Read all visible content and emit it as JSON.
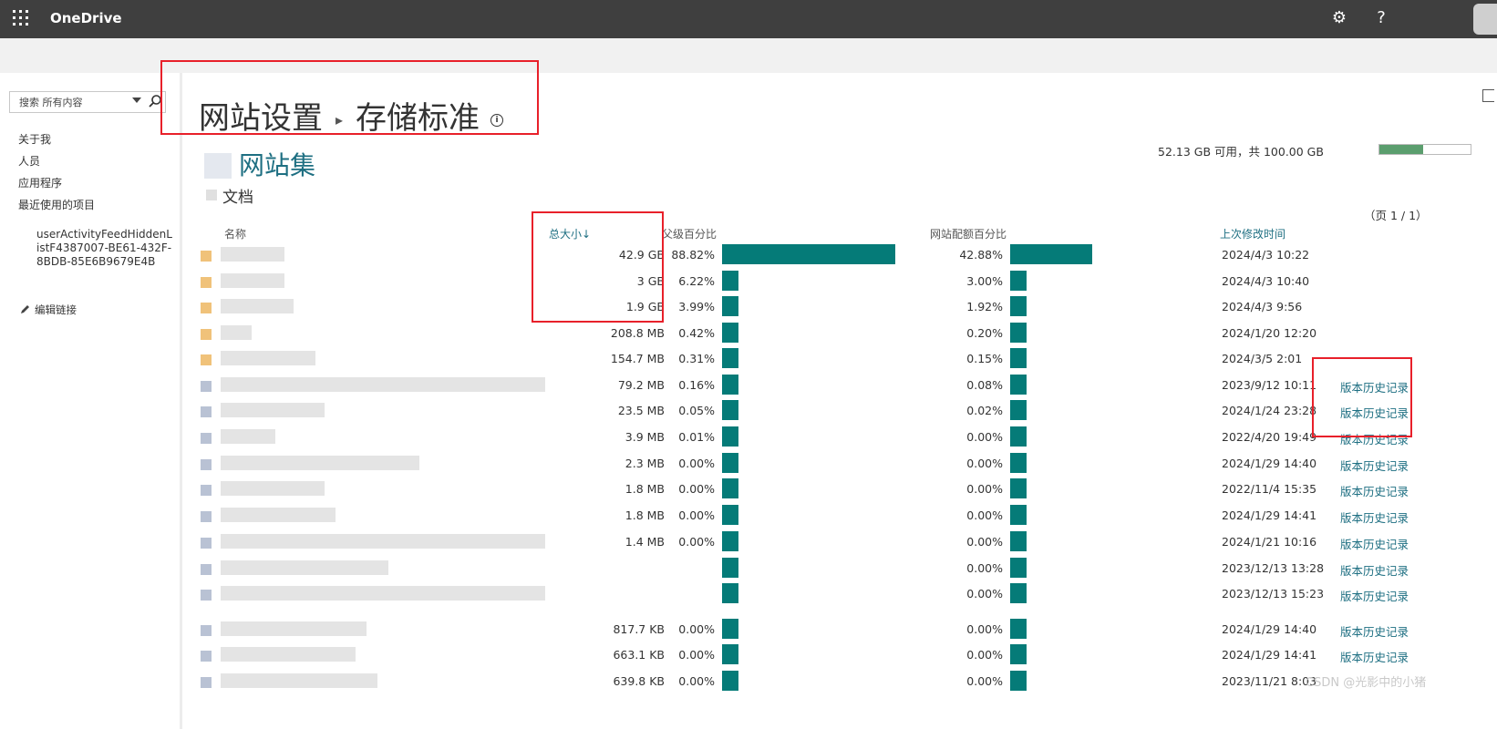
{
  "topbar": {
    "brand": "OneDrive",
    "help": "?"
  },
  "sidebar": {
    "search_placeholder": "搜索 所有内容",
    "nav": [
      "关于我",
      "人员",
      "应用程序",
      "最近使用的项目"
    ],
    "recent_item": "userActivityFeedHiddenListF4387007-BE61-432F-8BDB-85E6B9679E4B",
    "edit_links": "编辑链接"
  },
  "header": {
    "crumb_site_settings": "网站设置",
    "crumb_storage_metrics": "存储标准",
    "section_title": "网站集",
    "sub_title": "文档",
    "quota_text": "52.13 GB 可用，共 100.00 GB",
    "quota_used_fraction": 0.48,
    "pager": "（页 1 / 1）"
  },
  "table": {
    "col_name": "名称",
    "col_total_size": "总大小",
    "col_parent_pct": "父级百分比",
    "col_quota_pct": "网站配额百分比",
    "col_modified": "上次修改时间",
    "rows": [
      {
        "size": "42.9 GB",
        "parent_pct": "88.82%",
        "parent_val": 88.82,
        "quota_pct": "42.88%",
        "quota_val": 42.88,
        "modified": "2024/4/3 10:22",
        "history": "",
        "type": "folder",
        "name_w": 70
      },
      {
        "size": "3 GB",
        "parent_pct": "6.22%",
        "parent_val": 6.22,
        "quota_pct": "3.00%",
        "quota_val": 3.0,
        "modified": "2024/4/3 10:40",
        "history": "",
        "type": "folder",
        "name_w": 70
      },
      {
        "size": "1.9 GB",
        "parent_pct": "3.99%",
        "parent_val": 3.99,
        "quota_pct": "1.92%",
        "quota_val": 1.92,
        "modified": "2024/4/3 9:56",
        "history": "",
        "type": "folder",
        "name_w": 80
      },
      {
        "size": "208.8 MB",
        "parent_pct": "0.42%",
        "parent_val": 0.42,
        "quota_pct": "0.20%",
        "quota_val": 0.2,
        "modified": "2024/1/20 12:20",
        "history": "",
        "type": "folder",
        "name_w": 34
      },
      {
        "size": "154.7 MB",
        "parent_pct": "0.31%",
        "parent_val": 0.31,
        "quota_pct": "0.15%",
        "quota_val": 0.15,
        "modified": "2024/3/5 2:01",
        "history": "",
        "type": "folder",
        "name_w": 104
      },
      {
        "size": "79.2 MB",
        "parent_pct": "0.16%",
        "parent_val": 0.16,
        "quota_pct": "0.08%",
        "quota_val": 0.08,
        "modified": "2023/9/12 10:11",
        "history": "版本历史记录",
        "type": "file",
        "name_w": 356
      },
      {
        "size": "23.5 MB",
        "parent_pct": "0.05%",
        "parent_val": 0.05,
        "quota_pct": "0.02%",
        "quota_val": 0.02,
        "modified": "2024/1/24 23:28",
        "history": "版本历史记录",
        "type": "file",
        "name_w": 114
      },
      {
        "size": "3.9 MB",
        "parent_pct": "0.01%",
        "parent_val": 0.01,
        "quota_pct": "0.00%",
        "quota_val": 0.0,
        "modified": "2022/4/20 19:49",
        "history": "版本历史记录",
        "type": "file",
        "name_w": 60
      },
      {
        "size": "2.3 MB",
        "parent_pct": "0.00%",
        "parent_val": 0.0,
        "quota_pct": "0.00%",
        "quota_val": 0.0,
        "modified": "2024/1/29 14:40",
        "history": "版本历史记录",
        "type": "file",
        "name_w": 218
      },
      {
        "size": "1.8 MB",
        "parent_pct": "0.00%",
        "parent_val": 0.0,
        "quota_pct": "0.00%",
        "quota_val": 0.0,
        "modified": "2022/11/4 15:35",
        "history": "版本历史记录",
        "type": "file",
        "name_w": 114
      },
      {
        "size": "1.8 MB",
        "parent_pct": "0.00%",
        "parent_val": 0.0,
        "quota_pct": "0.00%",
        "quota_val": 0.0,
        "modified": "2024/1/29 14:41",
        "history": "版本历史记录",
        "type": "file",
        "name_w": 126
      },
      {
        "size": "1.4 MB",
        "parent_pct": "0.00%",
        "parent_val": 0.0,
        "quota_pct": "0.00%",
        "quota_val": 0.0,
        "modified": "2024/1/21 10:16",
        "history": "版本历史记录",
        "type": "file",
        "name_w": 356
      },
      {
        "size": "",
        "parent_pct": "",
        "parent_val": 0.0,
        "quota_pct": "0.00%",
        "quota_val": 0.0,
        "modified": "2023/12/13 13:28",
        "history": "版本历史记录",
        "type": "file",
        "name_w": 184
      },
      {
        "size": "",
        "parent_pct": "",
        "parent_val": 0.0,
        "quota_pct": "0.00%",
        "quota_val": 0.0,
        "modified": "2023/12/13 15:23",
        "history": "版本历史记录",
        "type": "file",
        "name_w": 356
      },
      {
        "size": "817.7 KB",
        "parent_pct": "0.00%",
        "parent_val": 0.0,
        "quota_pct": "0.00%",
        "quota_val": 0.0,
        "modified": "2024/1/29 14:40",
        "history": "版本历史记录",
        "type": "file",
        "name_w": 160
      },
      {
        "size": "663.1 KB",
        "parent_pct": "0.00%",
        "parent_val": 0.0,
        "quota_pct": "0.00%",
        "quota_val": 0.0,
        "modified": "2024/1/29 14:41",
        "history": "版本历史记录",
        "type": "file",
        "name_w": 148
      },
      {
        "size": "639.8 KB",
        "parent_pct": "0.00%",
        "parent_val": 0.0,
        "quota_pct": "0.00%",
        "quota_val": 0.0,
        "modified": "2023/11/21 8:03",
        "history": "",
        "type": "file",
        "name_w": 172
      }
    ]
  },
  "watermark": "CSDN @光影中的小猪",
  "colors": {
    "topbar": "#3f3f3f",
    "accent": "#1e6f82",
    "bar": "#057b78",
    "highlight": "#e8202a",
    "quota": "#5b9e6e"
  }
}
